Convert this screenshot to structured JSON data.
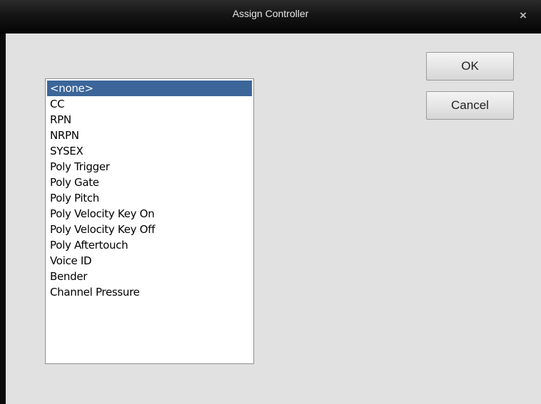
{
  "window": {
    "title": "Assign Controller",
    "close_glyph": "×"
  },
  "list": {
    "items": [
      "<none>",
      "CC",
      "RPN",
      "NRPN",
      "SYSEX",
      "Poly Trigger",
      "Poly Gate",
      "Poly Pitch",
      "Poly Velocity Key On",
      "Poly Velocity Key Off",
      "Poly Aftertouch",
      "Voice ID",
      "Bender",
      "Channel Pressure"
    ],
    "selected": "<none>"
  },
  "buttons": {
    "ok": "OK",
    "cancel": "Cancel"
  },
  "colors": {
    "selection": "#3c6699",
    "dialog_bg": "#e1e1e1",
    "titlebar": "#111111"
  }
}
